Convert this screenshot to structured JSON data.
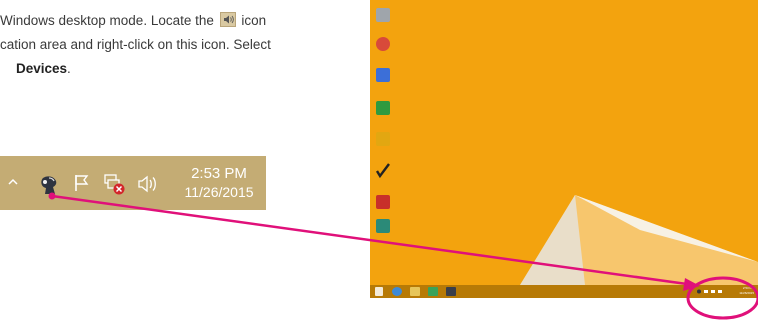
{
  "instructions": {
    "line1_before": "Windows desktop mode. Locate the",
    "line1_after": "icon",
    "line2": "cation area and right-click on this icon. Select",
    "line3_bold": "Devices",
    "line3_tail": "."
  },
  "zoomed_tray": {
    "time": "2:53 PM",
    "date": "11/26/2015",
    "icons": [
      "show-hidden-icons-arrow",
      "realtek-audio-manager-icon",
      "action-center-flag-icon",
      "network-disconnected-icon",
      "speaker-volume-icon"
    ]
  },
  "desktop": {
    "background_color": "#f3a30e",
    "taskbar_color": "#b77a06",
    "icons": [
      {
        "name": "recycle-bin-icon",
        "color": "#9fa5ab"
      },
      {
        "name": "google-chrome-icon",
        "color": "#d84a3a"
      },
      {
        "name": "google-docs-icon",
        "color": "#3c6fd8"
      },
      {
        "name": "google-sheets-icon",
        "color": "#2f9a3f"
      },
      {
        "name": "google-slides-icon",
        "color": "#e2a711"
      },
      {
        "name": "nero-icon",
        "color": "#dddddd"
      },
      {
        "name": "app-red-icon",
        "color": "#c8302a"
      },
      {
        "name": "app-green-icon",
        "color": "#2b8a78"
      }
    ],
    "taskbar_items": [
      "start-button-icon",
      "internet-explorer-icon",
      "file-explorer-icon",
      "store-icon",
      "realtek-taskbar-icon"
    ]
  },
  "colors": {
    "arrow": "#e0107a",
    "highlight_ring": "#e0107a"
  }
}
